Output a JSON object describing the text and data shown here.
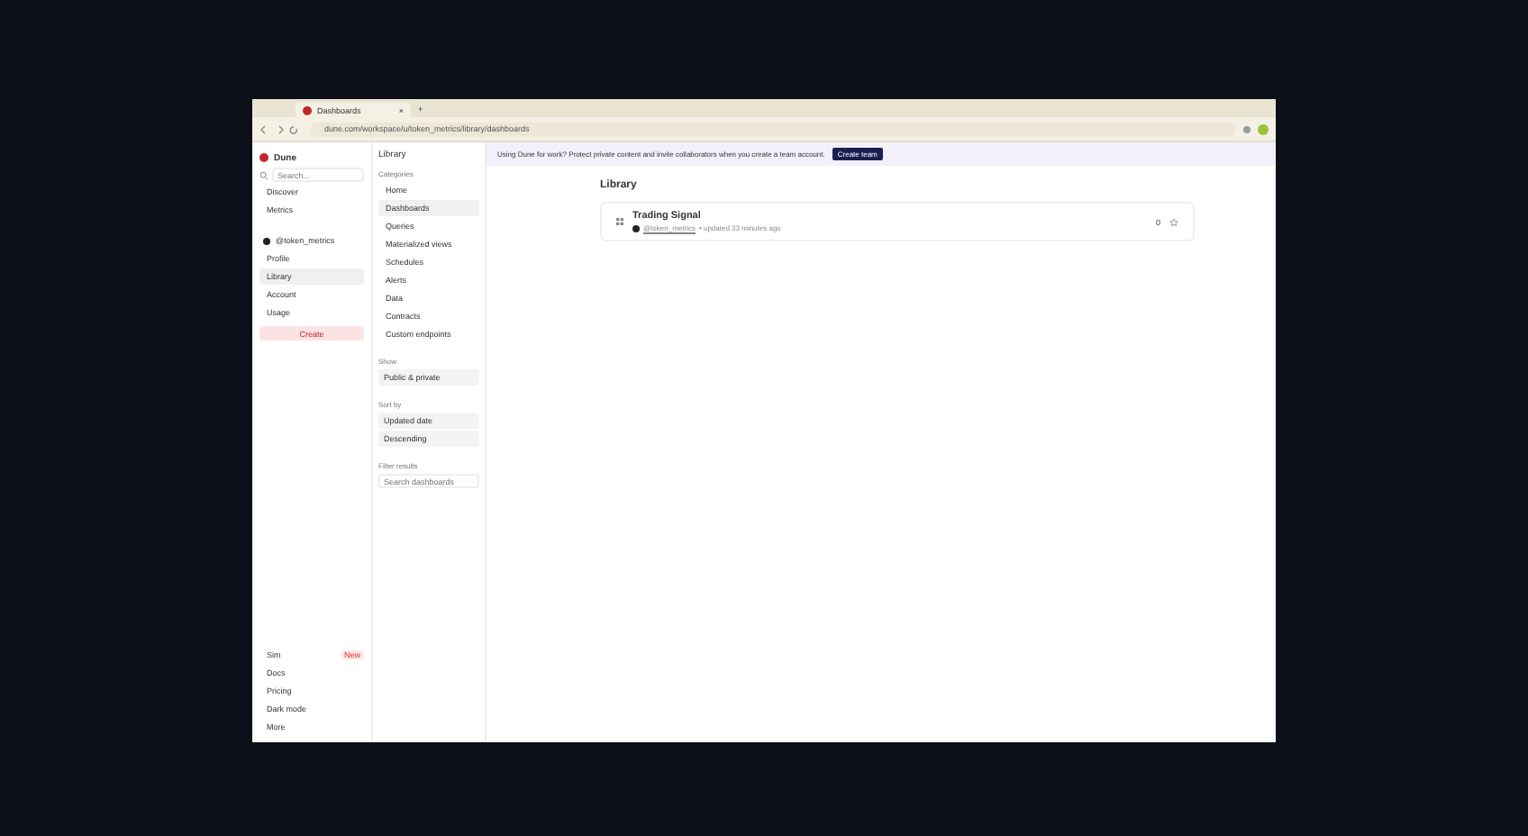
{
  "browser": {
    "tab": {
      "title": "Dashboards",
      "close": "×"
    },
    "new_tab": "+",
    "url": "dune.com/workspace/u/token_metrics/library/dashboards"
  },
  "sidebar": {
    "brand": "Dune",
    "search": {
      "placeholder": "Search..."
    },
    "nav": [
      {
        "label": "Discover",
        "selected": false
      },
      {
        "label": "Metrics",
        "selected": false
      }
    ],
    "user": "@token_metrics",
    "user_nav": [
      {
        "label": "Profile",
        "selected": false
      },
      {
        "label": "Library",
        "selected": true
      },
      {
        "label": "Account",
        "selected": false
      },
      {
        "label": "Usage",
        "selected": false
      }
    ],
    "create": "Create",
    "footer": [
      {
        "label": "Sim",
        "badge": "New"
      },
      {
        "label": "Docs"
      },
      {
        "label": "Pricing"
      },
      {
        "label": "Dark mode"
      },
      {
        "label": "More"
      }
    ]
  },
  "library": {
    "title": "Library",
    "categories_label": "Categories",
    "categories": [
      {
        "label": "Home",
        "selected": false
      },
      {
        "label": "Dashboards",
        "selected": true
      },
      {
        "label": "Queries",
        "selected": false
      },
      {
        "label": "Materialized views",
        "selected": false
      },
      {
        "label": "Schedules",
        "selected": false
      },
      {
        "label": "Alerts",
        "selected": false
      },
      {
        "label": "Data",
        "selected": false
      },
      {
        "label": "Contracts",
        "selected": false
      },
      {
        "label": "Custom endpoints",
        "selected": false
      }
    ],
    "show": {
      "label": "Show",
      "value": "Public & private"
    },
    "sort": {
      "label": "Sort by",
      "values": [
        "Updated date",
        "Descending"
      ]
    },
    "filter": {
      "label": "Filter results",
      "placeholder": "Search dashboards"
    }
  },
  "banner": {
    "text": "Using Dune for work? Protect private content and invite collaborators when you create a team account.",
    "button": "Create team"
  },
  "main": {
    "title": "Library",
    "items": [
      {
        "title": "Trading Signal",
        "owner": "@token_metrics",
        "meta": "• updated 33 minutes ago",
        "star_count": "0"
      }
    ]
  }
}
